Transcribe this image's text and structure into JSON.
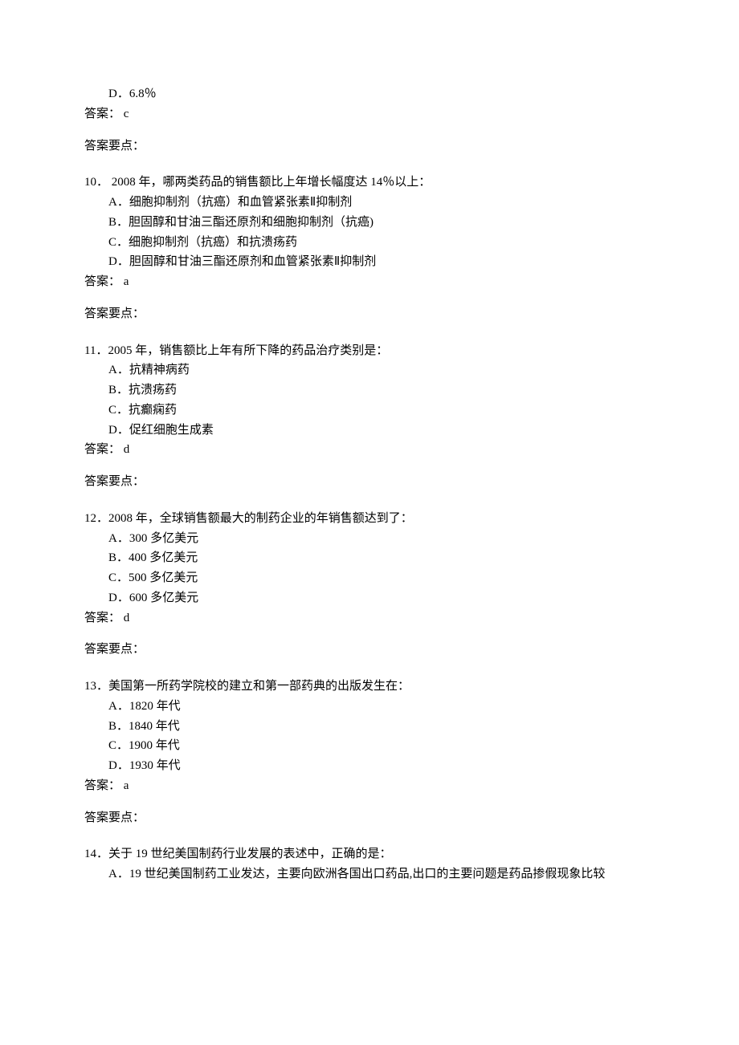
{
  "q9_tail": {
    "optD": "D．6.8％",
    "answer": "答案：  c",
    "keypoint": "答案要点："
  },
  "q10": {
    "text": "10．  2008 年，哪两类药品的销售额比上年增长幅度达 14％以上：",
    "optA": "A．细胞抑制剂（抗癌）和血管紧张素Ⅱ抑制剂",
    "optB": "B．胆固醇和甘油三酯还原剂和细胞抑制剂（抗癌)",
    "optC": "C．细胞抑制剂（抗癌）和抗溃疡药",
    "optD": "D．胆固醇和甘油三酯还原剂和血管紧张素Ⅱ抑制剂",
    "answer": "答案：  a",
    "keypoint": "答案要点："
  },
  "q11": {
    "text": "11．2005 年，销售额比上年有所下降的药品治疗类别是：",
    "optA": "A．抗精神病药",
    "optB": "B．抗溃疡药",
    "optC": "C．抗癫痫药",
    "optD": "D．促红细胞生成素",
    "answer": "答案：  d",
    "keypoint": "答案要点："
  },
  "q12": {
    "text": "12．2008 年，全球销售额最大的制药企业的年销售额达到了：",
    "optA": "A．300 多亿美元",
    "optB": "B．400 多亿美元",
    "optC": "C．500 多亿美元",
    "optD": "D．600 多亿美元",
    "answer": "答案：  d",
    "keypoint": "答案要点："
  },
  "q13": {
    "text": "13．美国第一所药学院校的建立和第一部药典的出版发生在：",
    "optA": "A．1820 年代",
    "optB": "B．1840 年代",
    "optC": "C．1900 年代",
    "optD": "D．1930 年代",
    "answer": "答案：  a",
    "keypoint": "答案要点："
  },
  "q14": {
    "text": "14．关于 19 世纪美国制药行业发展的表述中，正确的是：",
    "optA": "A．19 世纪美国制药工业发达，主要向欧洲各国出口药品,出口的主要问题是药品掺假现象比较"
  }
}
